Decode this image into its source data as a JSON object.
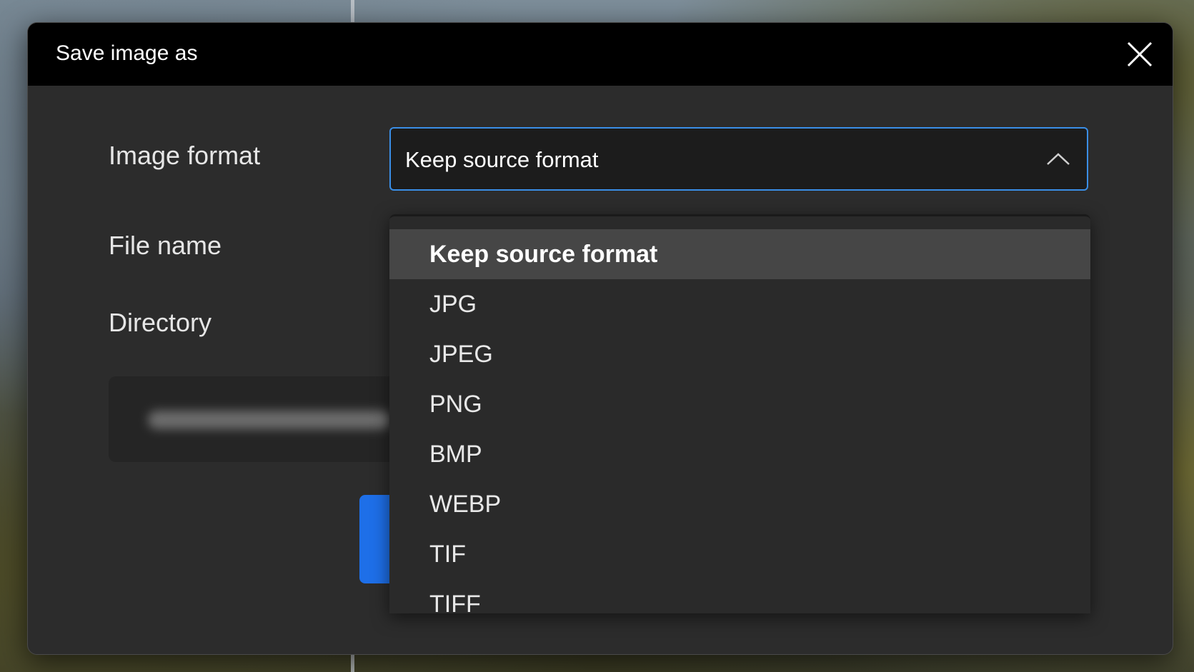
{
  "dialog": {
    "title": "Save image as",
    "close_icon": "close-icon"
  },
  "form": {
    "image_format_label": "Image format",
    "file_name_label": "File name",
    "directory_label": "Directory",
    "selected_format": "Keep source format",
    "chevron_icon": "chevron-up-icon"
  },
  "dropdown": {
    "options": [
      {
        "label": "Keep source format",
        "selected": true
      },
      {
        "label": "JPG",
        "selected": false
      },
      {
        "label": "JPEG",
        "selected": false
      },
      {
        "label": "PNG",
        "selected": false
      },
      {
        "label": "BMP",
        "selected": false
      },
      {
        "label": "WEBP",
        "selected": false
      },
      {
        "label": "TIF",
        "selected": false
      },
      {
        "label": "TIFF",
        "selected": false
      }
    ]
  },
  "colors": {
    "accent": "#3a8ee6",
    "primary_button": "#1e6fe8",
    "titlebar": "#000000",
    "dialog_background": "#2c2c2c",
    "selected_option": "#464646"
  }
}
